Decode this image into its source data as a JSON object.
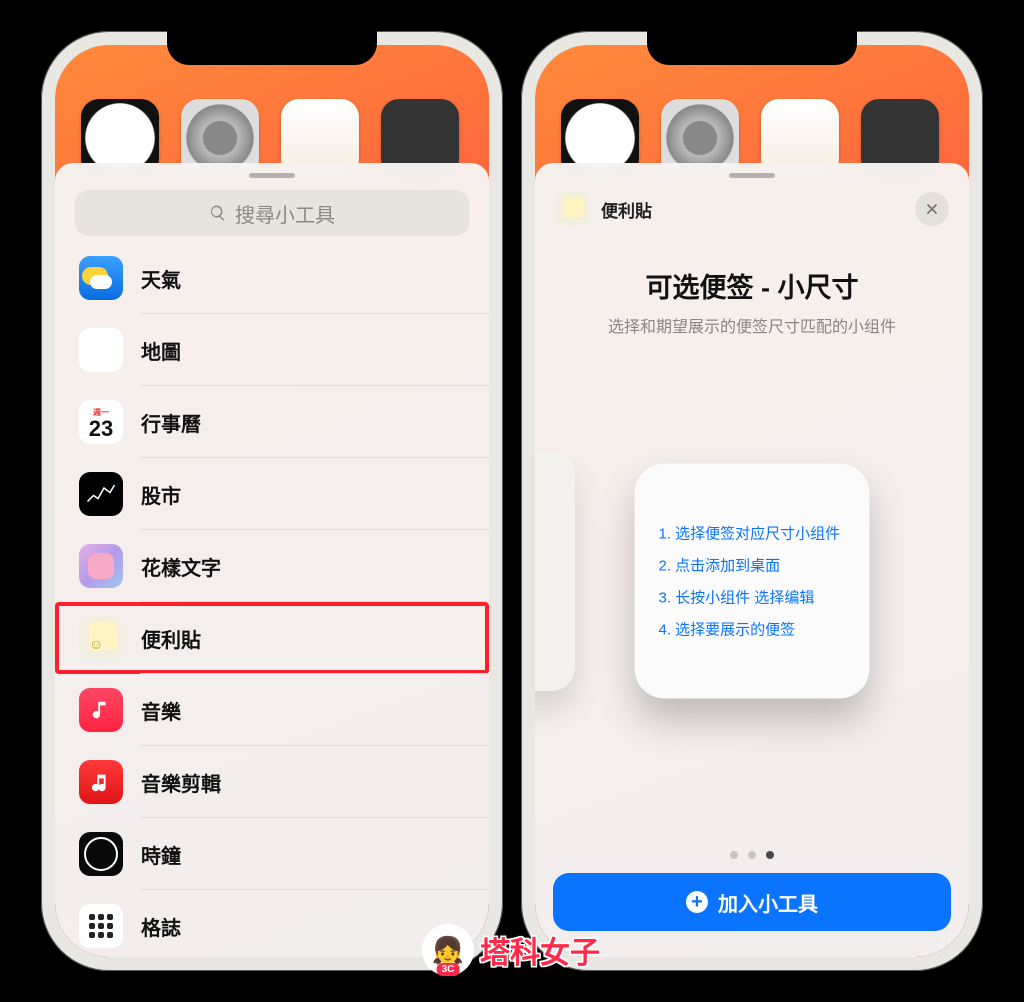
{
  "left": {
    "search_placeholder": "搜尋小工具",
    "items": [
      {
        "label": "天氣"
      },
      {
        "label": "地圖"
      },
      {
        "label": "行事曆",
        "day_label": "週一",
        "day_num": "23"
      },
      {
        "label": "股市"
      },
      {
        "label": "花樣文字"
      },
      {
        "label": "便利貼"
      },
      {
        "label": "音樂"
      },
      {
        "label": "音樂剪輯"
      },
      {
        "label": "時鐘"
      },
      {
        "label": "格誌"
      }
    ]
  },
  "right": {
    "app_name": "便利貼",
    "title": "可选便签 - 小尺寸",
    "subtitle": "选择和期望展示的便签尺寸匹配的小组件",
    "steps": [
      "1. 选择便签对应尺寸小组件",
      "2. 点击添加到桌面",
      "3. 长按小组件 选择编辑",
      "4. 选择要展示的便签"
    ],
    "page_index": 2,
    "page_count": 3,
    "add_label": "加入小工具"
  },
  "watermark": "塔科女子"
}
